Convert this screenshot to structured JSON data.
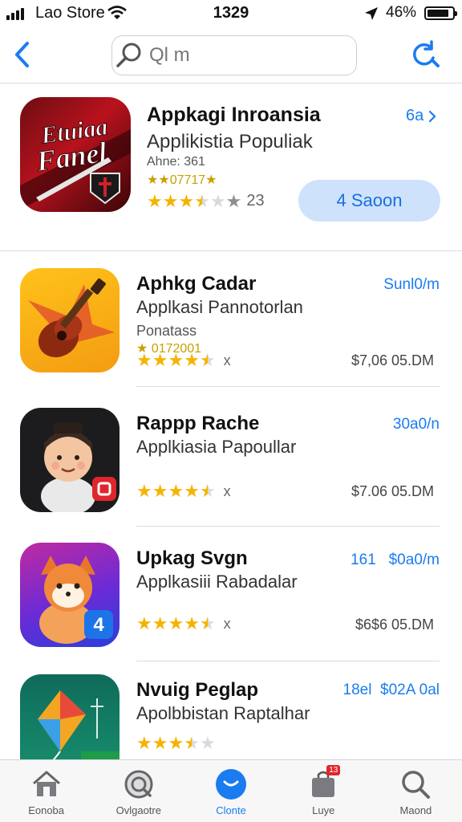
{
  "status_bar": {
    "carrier": "Lao Store",
    "time": "1329",
    "battery": "46%"
  },
  "nav": {
    "search_placeholder": "Ql m"
  },
  "featured": {
    "title": "Appkagi Inroansia",
    "subtitle": "Applikistia Populiak",
    "meta": "Ahne: 361",
    "rank": "★★07717★",
    "rating": 3.5,
    "rating_count": "23",
    "link_label": "6a",
    "get_label": "4 Saoon",
    "icon_text_line1": "Etuiaa",
    "icon_text_line2": "Fanel"
  },
  "apps": [
    {
      "title": "Aphkg Cadar",
      "subtitle": "Applkasi Pannotorlan",
      "meta": "Ponatass",
      "rank": "★ 0172001",
      "rating": 4.5,
      "rating_suffix": "x",
      "price": "$7,06 05.DM",
      "size": "Sunl0/m"
    },
    {
      "title": "Rappp Rache",
      "subtitle": "Applkiasia Papoullar",
      "meta": "",
      "rank": "",
      "rating": 4.5,
      "rating_suffix": "x",
      "price": "$7.06 05.DM",
      "size": "30a0/n"
    },
    {
      "title": "Upkag Svgn",
      "subtitle": "Applkasiii Rabadalar",
      "meta": "",
      "rank": "",
      "rating": 4.5,
      "rating_suffix": "x",
      "price": "$6$6 05.DM",
      "size": "161   $0a0/m"
    },
    {
      "title": "Nvuig Peglap",
      "subtitle": "Apolbbistan Raptalhar",
      "meta": "",
      "rank": "",
      "rating": 3.5,
      "rating_suffix": "",
      "price": "",
      "size": "18el  $02A 0al"
    }
  ],
  "tabs": [
    {
      "label": "Eonoba",
      "icon": "house-icon"
    },
    {
      "label": "Ovlgaotre",
      "icon": "explore-icon"
    },
    {
      "label": "Clonte",
      "icon": "chat-icon"
    },
    {
      "label": "Luye",
      "icon": "bag-icon",
      "badge": "13"
    },
    {
      "label": "Maond",
      "icon": "search-icon"
    }
  ],
  "colors": {
    "accent": "#1a7cf0",
    "star": "#f5b301"
  }
}
